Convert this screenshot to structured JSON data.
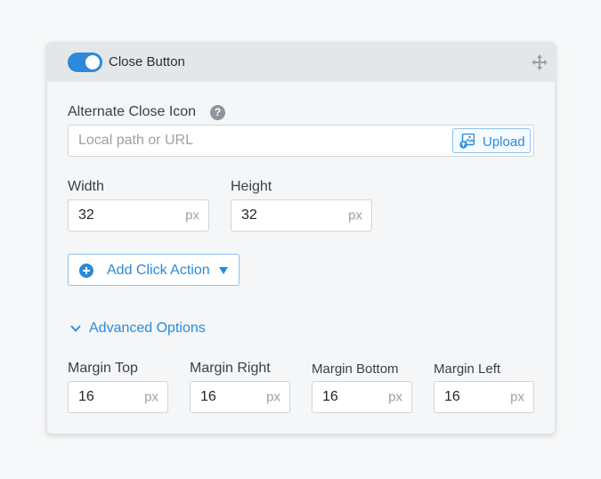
{
  "close_button": {
    "enabled": true,
    "title": "Close Button"
  },
  "alternate_icon": {
    "label": "Alternate Close Icon",
    "help": "?",
    "placeholder": "Local path or URL",
    "value": "",
    "upload_label": "Upload"
  },
  "size": {
    "width_label": "Width",
    "width_value": "32",
    "height_label": "Height",
    "height_value": "32",
    "unit": "px"
  },
  "click_action": {
    "label": "Add Click Action"
  },
  "advanced": {
    "label": "Advanced Options",
    "expanded": true,
    "unit": "px",
    "margins": [
      {
        "label": "Margin Top",
        "value": "16"
      },
      {
        "label": "Margin Right",
        "value": "16"
      },
      {
        "label": "Margin Bottom",
        "value": "16"
      },
      {
        "label": "Margin Left",
        "value": "16"
      }
    ]
  },
  "colors": {
    "accent": "#2b8ad9",
    "header_bg": "#e4e7ea",
    "panel_bg": "#f4f6f8"
  }
}
